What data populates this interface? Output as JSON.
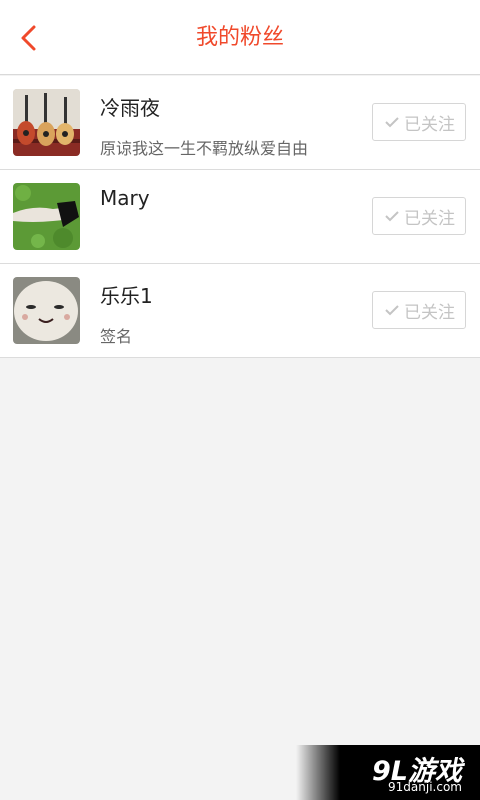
{
  "header": {
    "title": "我的粉丝",
    "back_icon": "chevron-left-icon",
    "accent_color": "#f0492b"
  },
  "fans": [
    {
      "name": "冷雨夜",
      "signature": "原谅我这一生不羁放纵爱自由",
      "avatar": "guitars-photo",
      "follow_label": "已关注"
    },
    {
      "name": "Mary",
      "signature": "",
      "avatar": "grass-photo",
      "follow_label": "已关注"
    },
    {
      "name": "乐乐1",
      "signature": "签名",
      "avatar": "plush-toy-photo",
      "follow_label": "已关注"
    }
  ],
  "watermark": {
    "logo": "9L游戏",
    "url": "91danji.com"
  }
}
